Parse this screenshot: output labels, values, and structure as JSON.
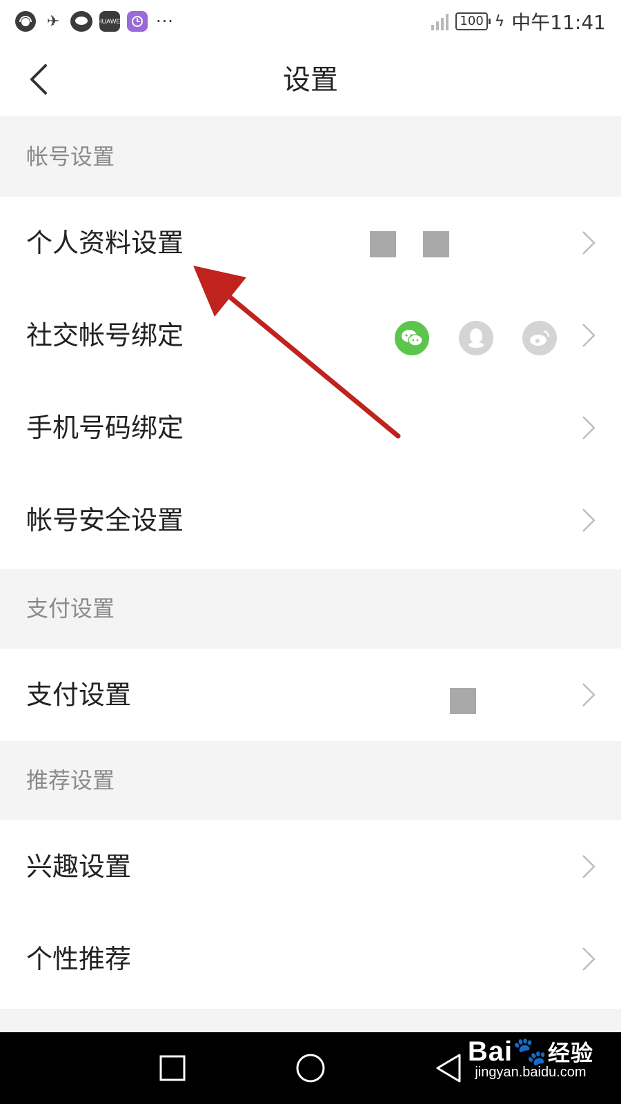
{
  "status_bar": {
    "huawei_label": "HUAWEI",
    "more": "···",
    "battery": "100",
    "time": "中午11:41"
  },
  "nav": {
    "title": "设置"
  },
  "sections": [
    {
      "header": "帐号设置",
      "items": [
        {
          "label": "个人资料设置"
        },
        {
          "label": "社交帐号绑定"
        },
        {
          "label": "手机号码绑定"
        },
        {
          "label": "帐号安全设置"
        }
      ]
    },
    {
      "header": "支付设置",
      "items": [
        {
          "label": "支付设置"
        }
      ]
    },
    {
      "header": "推荐设置",
      "items": [
        {
          "label": "兴趣设置"
        },
        {
          "label": "个性推荐"
        }
      ]
    }
  ],
  "watermark": {
    "brand": "Bai",
    "brand_cn": "经验",
    "url": "jingyan.baidu.com"
  },
  "colors": {
    "wechat": "#5cc64c",
    "annotation_arrow": "#c0231e",
    "section_bg": "#f4f4f4"
  }
}
